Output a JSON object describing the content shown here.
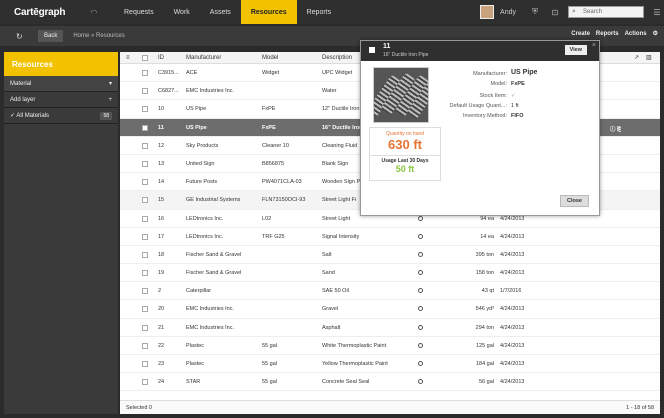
{
  "app": {
    "logo": "Cartēgraph"
  },
  "nav": [
    "Requests",
    "Work",
    "Assets",
    "Resources",
    "Reports"
  ],
  "user": {
    "name": "Andy"
  },
  "search": {
    "placeholder": "Search"
  },
  "toolbar": {
    "back": "Back",
    "crumbs": "Home  »  Resources",
    "create": "Create",
    "reports": "Reports",
    "actions": "Actions"
  },
  "sidebar": {
    "title": "Resources",
    "filter": "Material",
    "add_layer": "Add layer",
    "all_materials": "All Materials",
    "count": "58"
  },
  "table": {
    "headers": [
      "ID",
      "Manufacturer",
      "Model",
      "Description"
    ],
    "rows": [
      {
        "id": "C3915...",
        "mfr": "ACE",
        "model": "Widget",
        "desc": "UPC Widget",
        "date": "",
        "qty": ""
      },
      {
        "id": "C6827...",
        "mfr": "EMC Industries Inc.",
        "model": "",
        "desc": "Water",
        "date": "",
        "qty": ""
      },
      {
        "id": "10",
        "mfr": "US Pipe",
        "model": "FxPE",
        "desc": "12\" Ductile Iron",
        "date": "",
        "qty": ""
      },
      {
        "id": "11",
        "mfr": "US Pipe",
        "model": "FxPE",
        "desc": "16\" Ductile Iron",
        "date": "",
        "qty": ""
      },
      {
        "id": "12",
        "mfr": "Sky Products",
        "model": "Cleaner 10",
        "desc": "Cleaning Fluid",
        "date": "",
        "qty": ""
      },
      {
        "id": "13",
        "mfr": "United Sign",
        "model": "B856875",
        "desc": "Blank Sign",
        "date": "",
        "qty": ""
      },
      {
        "id": "14",
        "mfr": "Future Posts",
        "model": "PW4071CLA-03",
        "desc": "Wooden Sign P",
        "date": "",
        "qty": ""
      },
      {
        "id": "15",
        "mfr": "GE Industrial Systems",
        "model": "FLN73150OCI-93",
        "desc": "Street Light Fi",
        "date": "",
        "qty": ""
      },
      {
        "id": "16",
        "mfr": "LEDtronics Inc.",
        "model": "L02",
        "desc": "Street Light",
        "date": "4/24/2013",
        "qty": "94 ea"
      },
      {
        "id": "17",
        "mfr": "LEDtronics Inc.",
        "model": "TRF G25",
        "desc": "Signal Intensity",
        "date": "4/24/2013",
        "qty": "14 ea"
      },
      {
        "id": "18",
        "mfr": "Fischer Sand & Gravel",
        "model": "",
        "desc": "Salt",
        "date": "4/24/2013",
        "qty": "395 ton"
      },
      {
        "id": "19",
        "mfr": "Fischer Sand & Gravel",
        "model": "",
        "desc": "Sand",
        "date": "4/24/2013",
        "qty": "158 ton"
      },
      {
        "id": "2",
        "mfr": "Caterpillar",
        "model": "",
        "desc": "SAE 50 Oil",
        "date": "1/7/2016",
        "qty": "43 qt"
      },
      {
        "id": "20",
        "mfr": "EMC Industries Inc.",
        "model": "",
        "desc": "Gravel",
        "date": "4/24/2013",
        "qty": "546 yd³"
      },
      {
        "id": "21",
        "mfr": "EMC Industries Inc.",
        "model": "",
        "desc": "Asphalt",
        "date": "4/24/2013",
        "qty": "294 ton"
      },
      {
        "id": "22",
        "mfr": "Plastec",
        "model": "55 gal",
        "desc": "White Thermoplastic Paint",
        "date": "4/24/2013",
        "qty": "125 gal"
      },
      {
        "id": "23",
        "mfr": "Plastec",
        "model": "55 gal",
        "desc": "Yellow Thermoplastic Paint",
        "date": "4/24/2013",
        "qty": "184 gal"
      },
      {
        "id": "24",
        "mfr": "STAR",
        "model": "55 gal",
        "desc": "Concrete Seal Seal",
        "date": "4/24/2013",
        "qty": "56 gal"
      }
    ]
  },
  "footer": {
    "selected": "Selected 0",
    "pager": "1 - 18 of 58"
  },
  "popup": {
    "id": "11",
    "title": "16\" Ductile Iron Pipe",
    "view": "View",
    "qty_label": "Quantity on hand",
    "qty_value": "630 ft",
    "usage_label": "Usage Last 30 Days",
    "usage_value": "50 ft",
    "fields": [
      {
        "label": "Manufacturer:",
        "value": "US Pipe"
      },
      {
        "label": "Model:",
        "value": "FxPE"
      },
      {
        "label": "Stock Item:",
        "value": "✓"
      },
      {
        "label": "Default Usage Quant...:",
        "value": "1 ft"
      },
      {
        "label": "Inventory Method:",
        "value": "FIFO"
      }
    ],
    "close": "Close"
  },
  "colors": {
    "accent": "#f2c200",
    "qty": "#e57332",
    "usage": "#8dc63f"
  }
}
